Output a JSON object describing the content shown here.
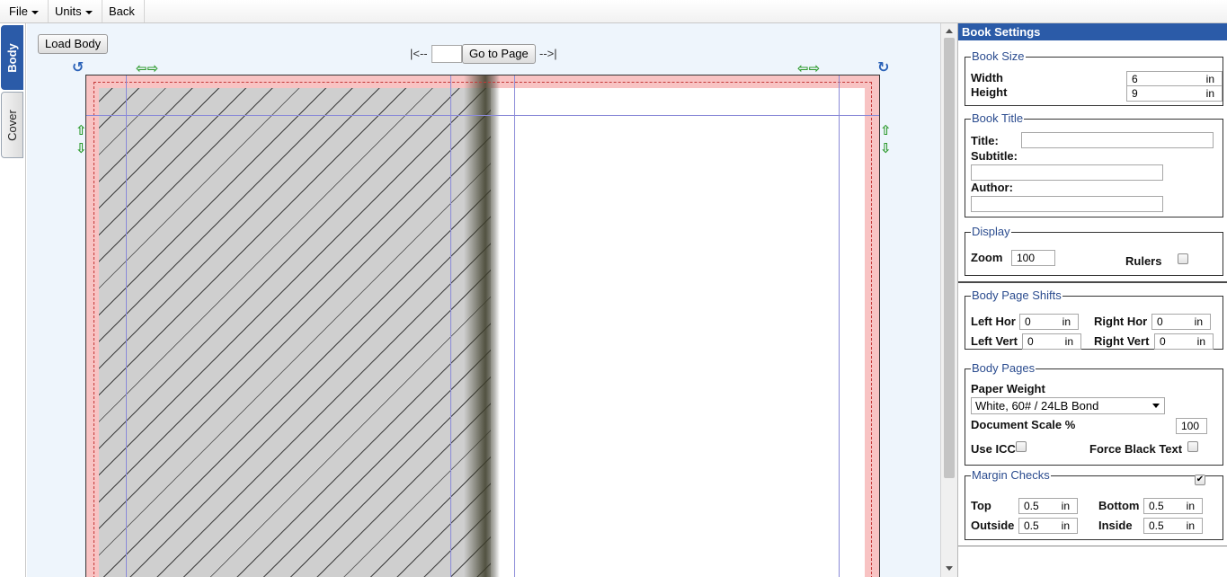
{
  "menubar": {
    "file": "File",
    "units": "Units",
    "back": "Back"
  },
  "tabs": {
    "body": "Body",
    "cover": "Cover"
  },
  "workspace": {
    "load_body": "Load Body",
    "nav_prev": "|<--",
    "nav_next": "-->|",
    "go_to_page": "Go to Page",
    "page_input": ""
  },
  "icons": {
    "rotate_left": "↺",
    "rotate_right": "↻",
    "arrows_h": "⇦⇨",
    "arrow_up": "⇧",
    "arrow_down": "⇩"
  },
  "panel": {
    "title": "Book Settings",
    "book_size": {
      "legend": "Book Size",
      "width_label": "Width",
      "width_value": "6",
      "height_label": "Height",
      "height_value": "9",
      "unit": "in"
    },
    "book_title": {
      "legend": "Book Title",
      "title_label": "Title:",
      "title_value": "",
      "subtitle_label": "Subtitle:",
      "subtitle_value": "",
      "author_label": "Author:",
      "author_value": ""
    },
    "display": {
      "legend": "Display",
      "zoom_label": "Zoom",
      "zoom_value": "100",
      "rulers_label": "Rulers"
    },
    "shifts": {
      "legend": "Body Page Shifts",
      "left_hor": "Left Hor",
      "left_hor_value": "0",
      "right_hor": "Right Hor",
      "right_hor_value": "0",
      "left_vert": "Left Vert",
      "left_vert_value": "0",
      "right_vert": "Right Vert",
      "right_vert_value": "0",
      "unit": "in"
    },
    "body_pages": {
      "legend": "Body Pages",
      "paper_weight_label": "Paper Weight",
      "paper_weight_value": "White, 60# / 24LB Bond",
      "doc_scale_label": "Document Scale %",
      "doc_scale_value": "100",
      "use_icc_label": "Use ICC",
      "force_black_label": "Force Black Text"
    },
    "margins": {
      "legend": "Margin Checks",
      "checked_mark": "✔",
      "top": "Top",
      "top_value": "0.5",
      "bottom": "Bottom",
      "bottom_value": "0.5",
      "outside": "Outside",
      "outside_value": "0.5",
      "inside": "Inside",
      "inside_value": "0.5",
      "unit": "in"
    }
  },
  "colors": {
    "accent": "#2b5ba8",
    "bleed": "#f8c3c3",
    "guide": "#8a8ad8",
    "arrow": "#2f9b2f"
  }
}
